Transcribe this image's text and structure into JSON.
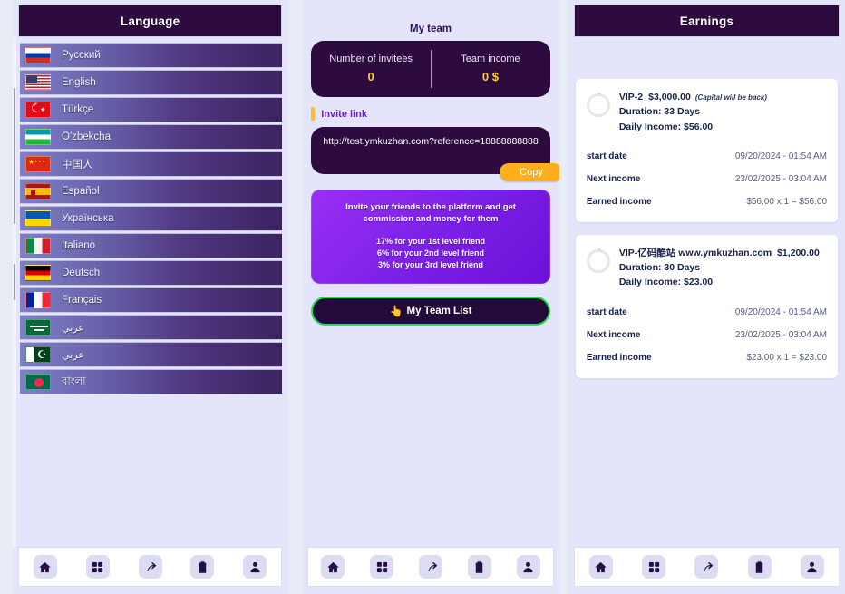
{
  "language_panel": {
    "header": "Language",
    "items": [
      {
        "label": "Русский",
        "flag": "russia-flag",
        "flag_class": "f-ru",
        "rtl": false
      },
      {
        "label": "English",
        "flag": "usa-flag",
        "flag_class": "f-us",
        "rtl": false
      },
      {
        "label": "Türkçe",
        "flag": "turkey-flag",
        "flag_class": "f-tr",
        "rtl": false
      },
      {
        "label": "O'zbekcha",
        "flag": "uzbekistan-flag",
        "flag_class": "f-uz",
        "rtl": false
      },
      {
        "label": "中国人",
        "flag": "china-flag",
        "flag_class": "f-cn",
        "rtl": false
      },
      {
        "label": "Español",
        "flag": "spain-flag",
        "flag_class": "f-es",
        "rtl": false
      },
      {
        "label": "Українська",
        "flag": "ukraine-flag",
        "flag_class": "f-ua",
        "rtl": false
      },
      {
        "label": "Italiano",
        "flag": "italy-flag",
        "flag_class": "f-it",
        "rtl": false
      },
      {
        "label": "Deutsch",
        "flag": "germany-flag",
        "flag_class": "f-de",
        "rtl": false
      },
      {
        "label": "Français",
        "flag": "france-flag",
        "flag_class": "f-fr",
        "rtl": false
      },
      {
        "label": "عربي",
        "flag": "saudi-arabia-flag",
        "flag_class": "f-sa",
        "rtl": true
      },
      {
        "label": "عربي",
        "flag": "pakistan-flag",
        "flag_class": "f-pk",
        "rtl": true
      },
      {
        "label": "বাংলা",
        "flag": "bangladesh-flag",
        "flag_class": "f-bd",
        "rtl": false
      }
    ]
  },
  "team_panel": {
    "title": "My team",
    "stats": {
      "invitees_label": "Number of invitees",
      "invitees_value": "0",
      "income_label": "Team income",
      "income_value": "0 $"
    },
    "invite_link_label": "Invite link",
    "invite_url": "http://test.ymkuzhan.com?reference=18888888888",
    "copy_button": "Copy",
    "promo": {
      "headline": "Invite your friends to the platform and get commission and money for them",
      "tier1": "17% for your 1st level friend",
      "tier2": "6% for your 2nd level friend",
      "tier3": "3% for your 3rd level friend"
    },
    "team_list_button": "My Team List",
    "team_list_icon": "👆"
  },
  "earnings_panel": {
    "header": "Earnings",
    "cards": [
      {
        "plan": "VIP-2",
        "amount": "$3,000.00",
        "note": "(Capital will be back)",
        "watermark": "",
        "domain": "",
        "duration": "Duration: 33 Days",
        "daily_income": "Daily Income: $56.00",
        "rows": [
          {
            "key": "start date",
            "value": "09/20/2024 - 01:54 AM"
          },
          {
            "key": "Next income",
            "value": "23/02/2025 - 03:04 AM"
          },
          {
            "key": "Earned income",
            "value": "$56.00 x 1 = $56.00"
          }
        ]
      },
      {
        "plan": "VIP-",
        "amount": "$1,200.00",
        "note": "",
        "watermark": "亿码酷站",
        "domain": "www.ymkuzhan.com",
        "duration": "Duration: 30 Days",
        "daily_income": "Daily Income: $23.00",
        "rows": [
          {
            "key": "start date",
            "value": "09/20/2024 - 01:54 AM"
          },
          {
            "key": "Next income",
            "value": "23/02/2025 - 03:04 AM"
          },
          {
            "key": "Earned income",
            "value": "$23.00 x 1 = $23.00"
          }
        ]
      }
    ]
  },
  "bottom_nav": {
    "items": [
      {
        "icon": "home-icon"
      },
      {
        "icon": "grid-icon"
      },
      {
        "icon": "arrow-up-right-icon"
      },
      {
        "icon": "clipboard-icon"
      },
      {
        "icon": "person-icon"
      }
    ]
  },
  "colors": {
    "header_purple": "#2d0b3e",
    "panel_bg": "#e4e4fb",
    "page_bg": "#e8ecf4",
    "accent_yellow": "#ffcf2e",
    "copy_orange": "#ffaf1c",
    "promo_purple": "#8a26f0",
    "green_border": "#21e04a",
    "link_purple": "#6a1fc9"
  }
}
